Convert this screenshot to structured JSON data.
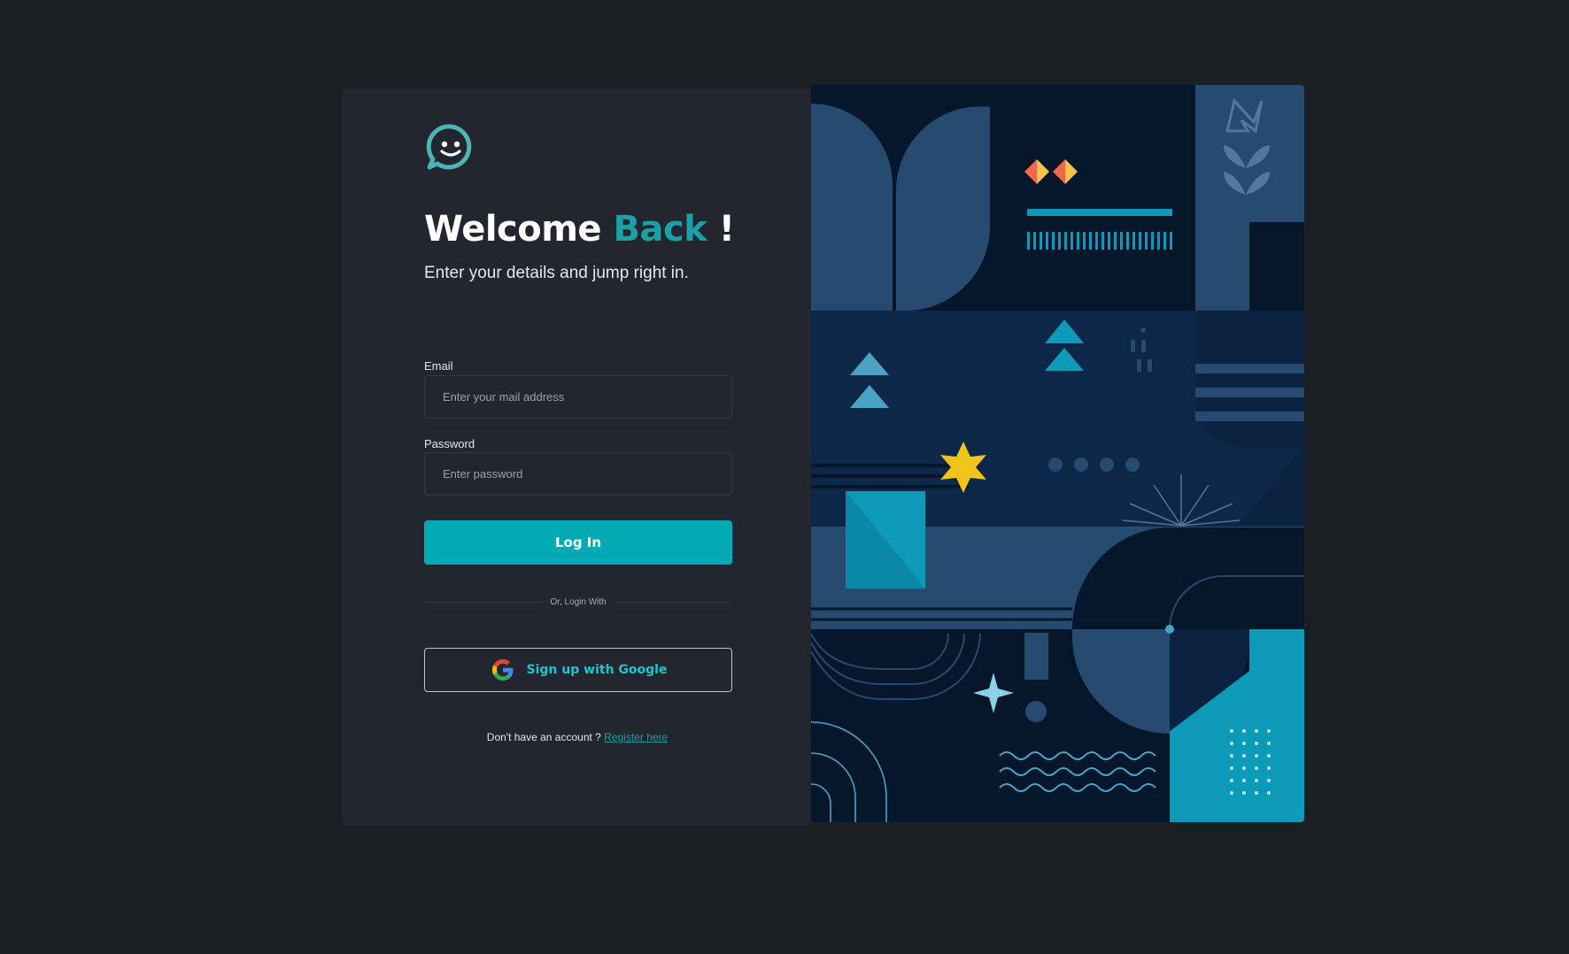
{
  "login": {
    "title_part1": "Welcome",
    "title_accent": "Back",
    "title_suffix": "!",
    "subtitle": "Enter your details and jump right in.",
    "email_label": "Email",
    "email_placeholder": "Enter your mail address",
    "email_value": "",
    "password_label": "Password",
    "password_placeholder": "Enter password",
    "password_value": "",
    "login_button": "Log In",
    "divider_text": "Or, Login With",
    "google_button": "Sign up with Google",
    "footer_text": "Don't have an account ?",
    "register_link": "Register here"
  },
  "icons": {
    "logo": "smiley-chat-bubble-icon",
    "google": "google-g-icon"
  },
  "colors": {
    "background": "#1b1f23",
    "panel": "#22272f",
    "accent": "#03aab4",
    "accent_text": "#1aa0a6",
    "illustration_dark": "#06162b",
    "illustration_mid": "#0d2748",
    "illustration_light": "#264a70",
    "yellow": "#f0c419",
    "orange": "#f3664a"
  }
}
